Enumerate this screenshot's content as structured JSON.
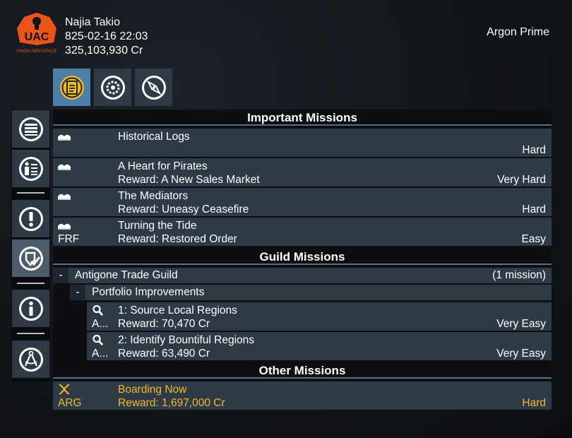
{
  "player": {
    "name": "Najia Takio",
    "datetime": "825-02-16 22:03",
    "credits": "325,103,930 Cr"
  },
  "location": "Argon Prime",
  "logo": {
    "text": "UAC",
    "subtext": "UNION AEROSPACE",
    "color": "#e8541a"
  },
  "top_tabs": [
    {
      "icon": "clipboard-icon",
      "active": true
    },
    {
      "icon": "gear-icon",
      "active": false
    },
    {
      "icon": "compass-icon",
      "active": false
    }
  ],
  "left_menu": [
    {
      "icon": "list-icon",
      "active": false
    },
    {
      "icon": "person-info-icon",
      "active": false
    },
    {
      "icon": "exclamation-icon",
      "active": false
    },
    {
      "icon": "check-shield-icon",
      "active": true
    },
    {
      "icon": "info-icon",
      "active": false
    },
    {
      "icon": "drafting-compass-icon",
      "active": false
    }
  ],
  "sections": {
    "important": "Important Missions",
    "guild": "Guild Missions",
    "other": "Other Missions"
  },
  "important_missions": [
    {
      "title": "Historical Logs",
      "reward": "",
      "difficulty": "Hard",
      "faction": ""
    },
    {
      "title": "A Heart for Pirates",
      "reward": "Reward: A New Sales Market",
      "difficulty": "Very Hard",
      "faction": ""
    },
    {
      "title": "The Mediators",
      "reward": "Reward: Uneasy Ceasefire",
      "difficulty": "Hard",
      "faction": ""
    },
    {
      "title": "Turning the Tide",
      "reward": "Reward: Restored Order",
      "difficulty": "Easy",
      "faction": "FRF"
    }
  ],
  "guild": {
    "toggle": "-",
    "name": "Antigone Trade Guild",
    "count": "(1 mission)",
    "sub": {
      "toggle": "-",
      "name": "Portfolio Improvements"
    },
    "missions": [
      {
        "title": "1: Source Local Regions",
        "reward": "Reward: 70,470 Cr",
        "difficulty": "Very Easy",
        "faction": "A..."
      },
      {
        "title": "2: Identify Bountiful Regions",
        "reward": "Reward: 63,490 Cr",
        "difficulty": "Very Easy",
        "faction": "A..."
      }
    ]
  },
  "other_missions": [
    {
      "title": "Boarding Now",
      "reward": "Reward: 1,697,000 Cr",
      "difficulty": "Hard",
      "faction": "ARG",
      "color": "#f0b92a"
    }
  ],
  "colors": {
    "accent": "#4d7ea8",
    "row": "#2e3a46",
    "gold": "#f0b92a",
    "separator": "#5b7088"
  }
}
